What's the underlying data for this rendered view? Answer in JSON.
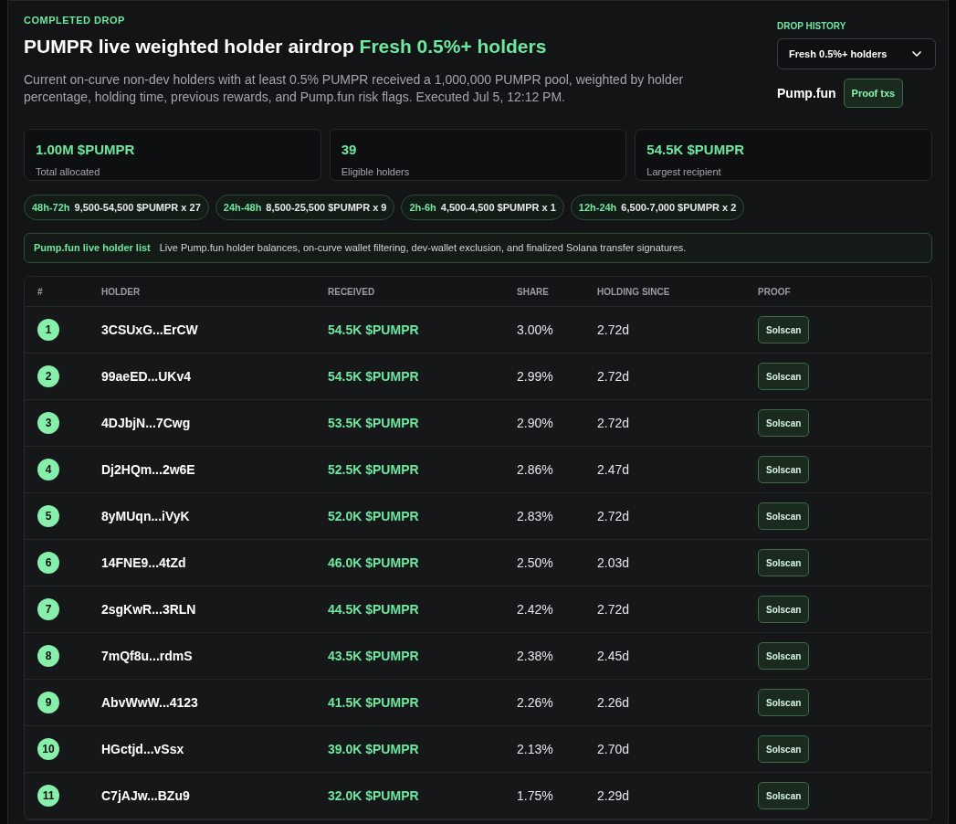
{
  "eyebrow": "COMPLETED DROP",
  "title": "PUMPR live weighted holder airdrop",
  "title_highlight": "Fresh 0.5%+ holders",
  "description": "Current on-curve non-dev holders with at least 0.5% PUMPR received a 1,000,000 PUMPR pool, weighted by holder percentage, holding time, previous rewards, and Pump.fun risk flags. Executed Jul 5, 12:12 PM.",
  "history": {
    "label": "DROP HISTORY",
    "value": "Fresh 0.5%+ holders",
    "source": "Pump.fun",
    "proof_button": "Proof txs"
  },
  "stats": [
    {
      "value": "1.00M $PUMPR",
      "label": "Total allocated"
    },
    {
      "value": "39",
      "label": "Eligible holders"
    },
    {
      "value": "54.5K $PUMPR",
      "label": "Largest recipient"
    }
  ],
  "tiers": [
    {
      "window": "48h-72h",
      "range": "9,500-54,500 $PUMPR x 27"
    },
    {
      "window": "24h-48h",
      "range": "8,500-25,500 $PUMPR x 9"
    },
    {
      "window": "2h-6h",
      "range": "4,500-4,500 $PUMPR x 1"
    },
    {
      "window": "12h-24h",
      "range": "6,500-7,000 $PUMPR x 2"
    }
  ],
  "info": {
    "label": "Pump.fun live holder list",
    "text": "Live Pump.fun holder balances, on-curve wallet filtering, dev-wallet exclusion, and finalized Solana transfer signatures."
  },
  "table": {
    "columns": [
      "#",
      "HOLDER",
      "RECEIVED",
      "SHARE",
      "HOLDING SINCE",
      "PROOF"
    ],
    "rows": [
      {
        "rank": "1",
        "holder": "3CSUxG...ErCW",
        "received": "54.5K $PUMPR",
        "share": "3.00%",
        "since": "2.72d",
        "proof": "Solscan"
      },
      {
        "rank": "2",
        "holder": "99aeED...UKv4",
        "received": "54.5K $PUMPR",
        "share": "2.99%",
        "since": "2.72d",
        "proof": "Solscan"
      },
      {
        "rank": "3",
        "holder": "4DJbjN...7Cwg",
        "received": "53.5K $PUMPR",
        "share": "2.90%",
        "since": "2.72d",
        "proof": "Solscan"
      },
      {
        "rank": "4",
        "holder": "Dj2HQm...2w6E",
        "received": "52.5K $PUMPR",
        "share": "2.86%",
        "since": "2.47d",
        "proof": "Solscan"
      },
      {
        "rank": "5",
        "holder": "8yMUqn...iVyK",
        "received": "52.0K $PUMPR",
        "share": "2.83%",
        "since": "2.72d",
        "proof": "Solscan"
      },
      {
        "rank": "6",
        "holder": "14FNE9...4tZd",
        "received": "46.0K $PUMPR",
        "share": "2.50%",
        "since": "2.03d",
        "proof": "Solscan"
      },
      {
        "rank": "7",
        "holder": "2sgKwR...3RLN",
        "received": "44.5K $PUMPR",
        "share": "2.42%",
        "since": "2.72d",
        "proof": "Solscan"
      },
      {
        "rank": "8",
        "holder": "7mQf8u...rdmS",
        "received": "43.5K $PUMPR",
        "share": "2.38%",
        "since": "2.45d",
        "proof": "Solscan"
      },
      {
        "rank": "9",
        "holder": "AbvWwW...4123",
        "received": "41.5K $PUMPR",
        "share": "2.26%",
        "since": "2.26d",
        "proof": "Solscan"
      },
      {
        "rank": "10",
        "holder": "HGctjd...vSsx",
        "received": "39.0K $PUMPR",
        "share": "2.13%",
        "since": "2.70d",
        "proof": "Solscan"
      },
      {
        "rank": "11",
        "holder": "C7jAJw...BZu9",
        "received": "32.0K $PUMPR",
        "share": "1.75%",
        "since": "2.29d",
        "proof": "Solscan"
      }
    ]
  }
}
